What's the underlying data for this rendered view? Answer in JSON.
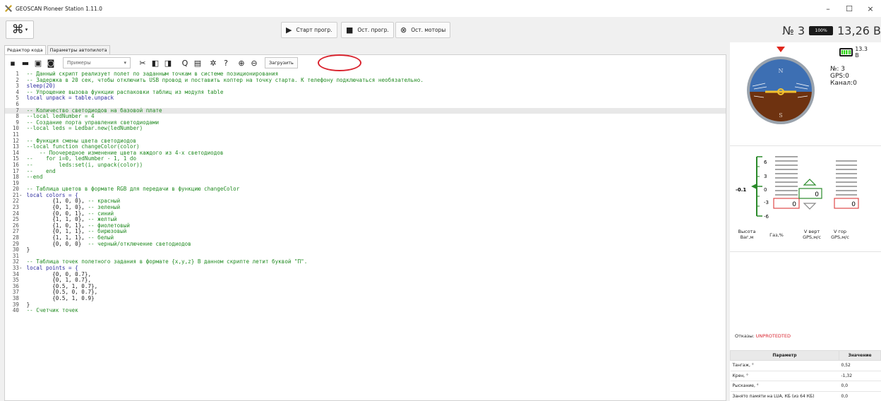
{
  "window": {
    "title": "GEOSCAN Pioneer Station 1.11.0",
    "minimize": "–",
    "maximize": "☐",
    "close": "×"
  },
  "toolbar": {
    "start_prog": "Старт прогр.",
    "stop_prog": "Ост. прогр.",
    "stop_motors": "Ост. моторы",
    "drone_number": "№ 3",
    "battery_badge": "100%",
    "voltage": "13,26 В"
  },
  "tabs": [
    {
      "label": "Редактор кода"
    },
    {
      "label": "Параметры автопилота"
    }
  ],
  "editor": {
    "examples_placeholder": "Примеры",
    "upload_label": "Загрузить",
    "icons": [
      "new-file-icon",
      "open-file-icon",
      "save-icon",
      "save-as-icon",
      "cut-icon",
      "copy-icon",
      "paste-icon",
      "search-icon",
      "replace-icon",
      "settings-icon",
      "help-icon",
      "zoom-in-icon",
      "zoom-out-icon"
    ],
    "lines": [
      "-- Данный скрипт реализует полет по заданным точкам в системе позиционирования",
      "-- Задержка в 20 сек, чтобы отключить USB провод и поставить коптер на точку старта. К телефону подключаться необязательно.",
      "sleep(20)",
      "-- Упрощение вызова функции распаковки таблиц из модуля table",
      "local unpack = table.unpack",
      "",
      "-- Количество светодиодов на базовой плате",
      "--local ledNumber = 4",
      "-- Создание порта управления светодиодами",
      "--local leds = Ledbar.new(ledNumber)",
      "",
      "-- Функция смены цвета светодиодов",
      "--local function changeColor(color)",
      "    -- Поочередное изменение цвета каждого из 4-х светодиодов",
      "--    for i=0, ledNumber - 1, 1 do",
      "--        leds:set(i, unpack(color))",
      "--    end",
      "--end",
      "",
      "-- Таблица цветов в формате RGB для передачи в функцию changeColor",
      "local colors = {",
      "        {1, 0, 0}, -- красный",
      "        {0, 1, 0}, -- зеленый",
      "        {0, 0, 1}, -- синий",
      "        {1, 1, 0}, -- желтый",
      "        {1, 0, 1}, -- фиолетовый",
      "        {0, 1, 1}, -- бирюзовый",
      "        {1, 1, 1}, -- белый",
      "        {0, 0, 0}  -- черный/отключение светодиодов",
      "}",
      "",
      "-- Таблица точек полетного задания в формате {x,y,z} В данном скрипте летит буквой \"П\".",
      "local points = {",
      "        {0, 0, 0.7},",
      "        {0, 1, 0.7},",
      "        {0.5, 1, 0.7},",
      "        {0.5, 0, 0.7},",
      "        {0.5, 1, 0.9}",
      "}",
      "-- Счетчик точек"
    ]
  },
  "right_panel": {
    "battery_voltage": "13.3 В",
    "battery_level": 1.0,
    "drone_no": "№: 3",
    "gps": "GPS:0",
    "channel": "Канал:0",
    "horizon_letters": {
      "n": "N",
      "s": "S"
    },
    "altitude_ticks": [
      "6",
      "3",
      "0",
      "-3",
      "-6"
    ],
    "altitude_value": "-0.1",
    "vvert_value": "0",
    "throttle_value": "0",
    "vhor_value": "0",
    "label_height": "Высота",
    "label_height2": "Ваг,м",
    "label_gas": "Газ,%",
    "label_vvert": "V верт",
    "label_vvert2": "GPS,м/с",
    "label_vhor": "V гор",
    "label_vhor2": "GPS,м/с",
    "otkaz_label": "Отказы:",
    "otkaz_value": "UNPROTEDTED",
    "table_headers": [
      "Параметр",
      "Значение"
    ],
    "table_rows": [
      {
        "param": "Тангаж, °",
        "value": "0,52"
      },
      {
        "param": "Крен, °",
        "value": "-1,32"
      },
      {
        "param": "Рыскание, °",
        "value": "0,0"
      },
      {
        "param": "Занято памяти на LUA, КБ (из 64 КБ)",
        "value": "0,0"
      }
    ]
  }
}
